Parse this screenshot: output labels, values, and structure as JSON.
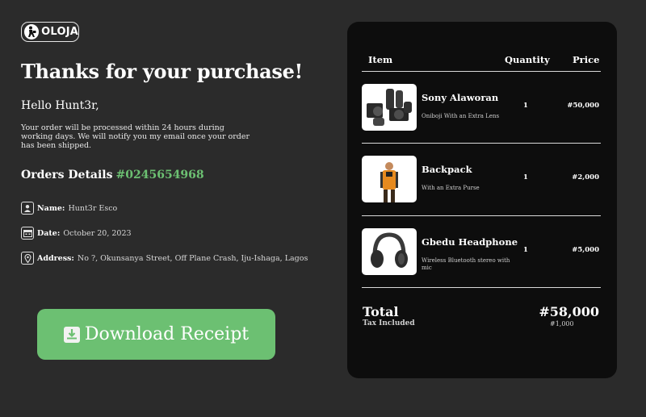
{
  "brand": {
    "name": "OLOJA"
  },
  "page": {
    "title": "Thanks for your purchase!",
    "greeting": "Hello Hunt3r,",
    "message": "Your order will be processed within 24 hours during working days. We will notify you my email once your order has been shipped."
  },
  "orders": {
    "label": "Orders Details",
    "number": "#0245654968"
  },
  "details": {
    "name_label": "Name:",
    "name_value": "Hunt3r Esco",
    "date_label": "Date:",
    "date_value": "October 20, 2023",
    "address_label": "Address:",
    "address_value": "No ?, Okunsanya Street, Off Plane Crash, Iju-Ishaga, Lagos"
  },
  "download": {
    "label": "Download Receipt"
  },
  "table": {
    "headers": {
      "item": "Item",
      "quantity": "Quantity",
      "price": "Price"
    },
    "items": [
      {
        "name": "Sony Alaworan",
        "desc": "Oniboji With an Extra Lens",
        "qty": "1",
        "price": "#50,000"
      },
      {
        "name": "Backpack",
        "desc": "With an Extra Purse",
        "qty": "1",
        "price": "#2,000"
      },
      {
        "name": "Gbedu Headphone",
        "desc": "Wireless Bluetooth stereo with mic",
        "qty": "1",
        "price": "#5,000"
      }
    ]
  },
  "summary": {
    "total_label": "Total",
    "total_value": "#58,000",
    "tax_label": "Tax Included",
    "tax_value": "#1,000"
  },
  "colors": {
    "background": "#2b2b2b",
    "card": "#0d0d0d",
    "accent": "#6cc072"
  },
  "icons": {
    "name": "user-icon",
    "date": "calendar-icon",
    "address": "location-pin-icon",
    "download": "download-icon"
  }
}
